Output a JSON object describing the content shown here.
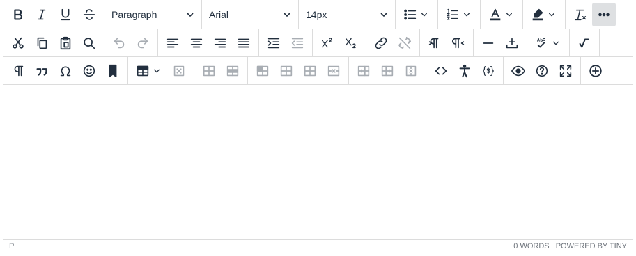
{
  "toolbar": {
    "block_format": "Paragraph",
    "font_family": "Arial",
    "font_size": "14px"
  },
  "status": {
    "path": "P",
    "word_count": "0 WORDS",
    "powered_by": "POWERED BY TINY"
  },
  "colors": {
    "icon": "#222f3e",
    "disabled_icon": "#a8adb3",
    "active_bg": "#dee0e2",
    "border": "#cccccc"
  }
}
